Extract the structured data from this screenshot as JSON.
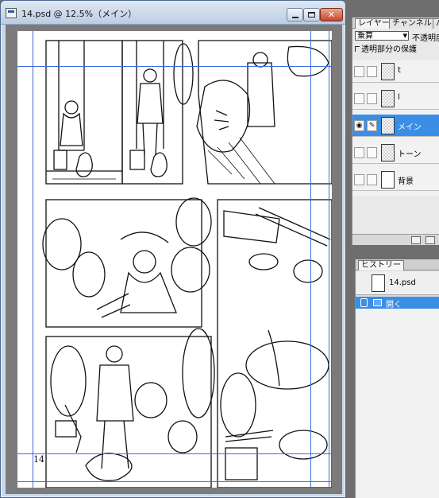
{
  "document_window": {
    "title": "14.psd @ 12.5%（メイン）",
    "page_number": "14"
  },
  "layers_panel": {
    "tabs": [
      "レイヤー",
      "チャンネル",
      "パス"
    ],
    "blend_mode": "乗算",
    "opacity_label": "不透明度",
    "lock_transparency_label": "透明部分の保護",
    "layers": [
      {
        "name": "t",
        "visible": false,
        "selected": false,
        "thumbnail": "transparent"
      },
      {
        "name": "l",
        "visible": false,
        "selected": false,
        "thumbnail": "transparent"
      },
      {
        "name": "メイン",
        "visible": true,
        "selected": true,
        "thumbnail": "transparent"
      },
      {
        "name": "トーン",
        "visible": false,
        "selected": false,
        "thumbnail": "transparent"
      },
      {
        "name": "背景",
        "visible": false,
        "selected": false,
        "thumbnail": "white"
      }
    ]
  },
  "history_panel": {
    "tab": "ヒストリー",
    "snapshot_name": "14.psd",
    "states": [
      {
        "name": "開く",
        "selected": true
      }
    ]
  },
  "colors": {
    "guide_blue": "#3c6ddc",
    "selection_blue": "#3a8ee6",
    "workspace_gray": "#7b7b7b"
  }
}
